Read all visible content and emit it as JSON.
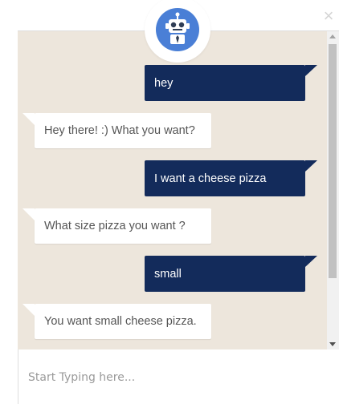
{
  "close": {
    "glyph": "×"
  },
  "avatar": {
    "icon": "robot-icon",
    "color": "#4a7fd6"
  },
  "messages": [
    {
      "sender": "user",
      "text": "hey"
    },
    {
      "sender": "bot",
      "text": "Hey there! :) What you want?"
    },
    {
      "sender": "user",
      "text": "I want a cheese pizza"
    },
    {
      "sender": "bot",
      "text": "What size pizza you want ?"
    },
    {
      "sender": "user",
      "text": "small"
    },
    {
      "sender": "bot",
      "text": "You want small cheese pizza."
    }
  ],
  "input": {
    "placeholder": "Start Typing here...",
    "value": ""
  },
  "colors": {
    "user_bubble": "#132b5b",
    "chat_background": "#ede6dc",
    "bot_bubble": "#ffffff"
  }
}
